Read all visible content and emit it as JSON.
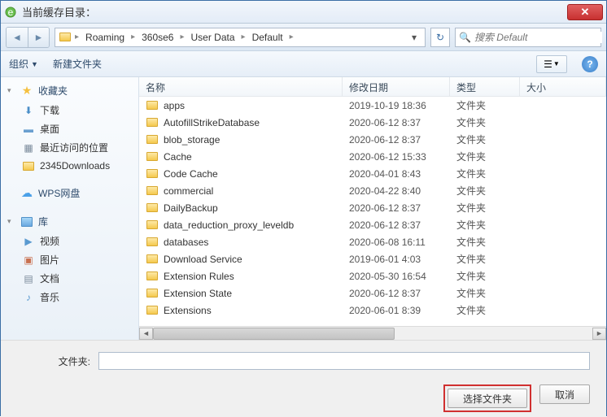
{
  "title": "当前缓存目录：",
  "breadcrumb": [
    "Roaming",
    "360se6",
    "User Data",
    "Default"
  ],
  "search_placeholder": "搜索 Default",
  "toolbar": {
    "organize": "组织",
    "new_folder": "新建文件夹"
  },
  "sidebar": {
    "favorites": {
      "label": "收藏夹",
      "items": [
        "下载",
        "桌面",
        "最近访问的位置",
        "2345Downloads"
      ]
    },
    "wps": "WPS网盘",
    "libraries": {
      "label": "库",
      "items": [
        "视频",
        "图片",
        "文档",
        "音乐"
      ]
    }
  },
  "columns": {
    "name": "名称",
    "date": "修改日期",
    "type": "类型",
    "size": "大小"
  },
  "type_folder": "文件夹",
  "files": [
    {
      "name": "apps",
      "date": "2019-10-19 18:36"
    },
    {
      "name": "AutofillStrikeDatabase",
      "date": "2020-06-12 8:37"
    },
    {
      "name": "blob_storage",
      "date": "2020-06-12 8:37"
    },
    {
      "name": "Cache",
      "date": "2020-06-12 15:33"
    },
    {
      "name": "Code Cache",
      "date": "2020-04-01 8:43"
    },
    {
      "name": "commercial",
      "date": "2020-04-22 8:40"
    },
    {
      "name": "DailyBackup",
      "date": "2020-06-12 8:37"
    },
    {
      "name": "data_reduction_proxy_leveldb",
      "date": "2020-06-12 8:37"
    },
    {
      "name": "databases",
      "date": "2020-06-08 16:11"
    },
    {
      "name": "Download Service",
      "date": "2019-06-01 4:03"
    },
    {
      "name": "Extension Rules",
      "date": "2020-05-30 16:54"
    },
    {
      "name": "Extension State",
      "date": "2020-06-12 8:37"
    },
    {
      "name": "Extensions",
      "date": "2020-06-01 8:39"
    }
  ],
  "filename_label": "文件夹:",
  "buttons": {
    "select": "选择文件夹",
    "cancel": "取消"
  }
}
